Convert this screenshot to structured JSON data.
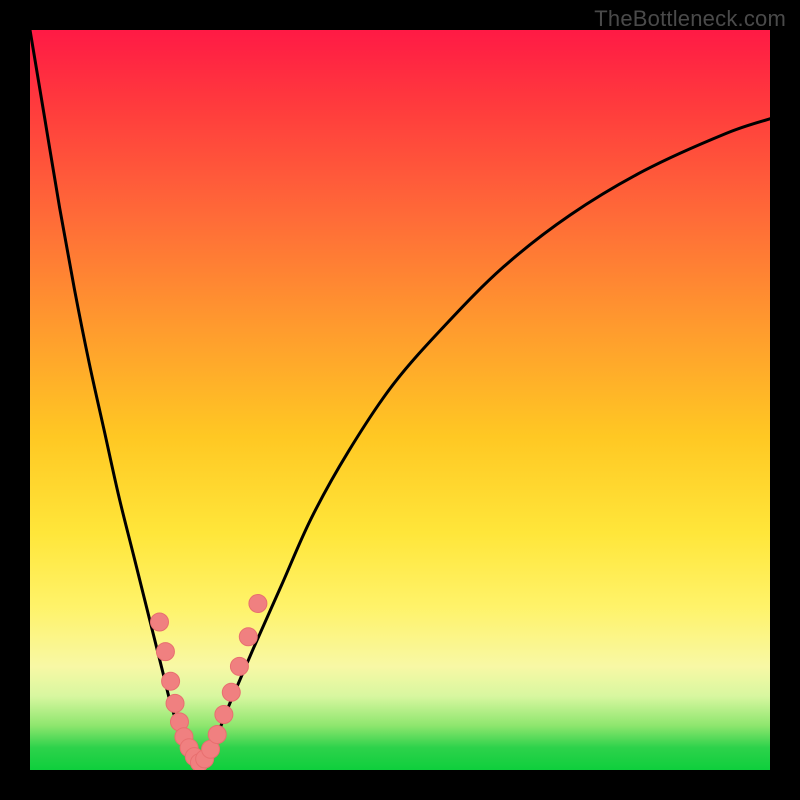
{
  "watermark": "TheBottleneck.com",
  "colors": {
    "frame": "#000000",
    "gradient_top": "#ff1a45",
    "gradient_mid1": "#ff9a2e",
    "gradient_mid2": "#ffe63a",
    "gradient_bottom": "#0ecf3c",
    "curve": "#000000",
    "marker_fill": "#f08080",
    "marker_stroke": "#e86f6f"
  },
  "chart_data": {
    "type": "line",
    "title": "",
    "xlabel": "",
    "ylabel": "",
    "xlim": [
      0,
      100
    ],
    "ylim": [
      0,
      100
    ],
    "note": "V-shaped bottleneck curve. x is relative component balance (0-100), y is bottleneck percentage (0=green/no bottleneck, 100=red/severe). Values are estimated from pixels since no axis ticks are shown.",
    "series": [
      {
        "name": "left-branch",
        "x": [
          0,
          2,
          4,
          6,
          8,
          10,
          12,
          14,
          16,
          18,
          19,
          20,
          21,
          22,
          23
        ],
        "values": [
          100,
          88,
          76,
          65,
          55,
          46,
          37,
          29,
          21,
          13,
          9,
          6,
          4,
          2,
          0
        ]
      },
      {
        "name": "right-branch",
        "x": [
          23,
          25,
          27,
          30,
          34,
          38,
          43,
          49,
          56,
          64,
          73,
          83,
          94,
          100
        ],
        "values": [
          0,
          4,
          9,
          16,
          25,
          34,
          43,
          52,
          60,
          68,
          75,
          81,
          86,
          88
        ]
      }
    ],
    "markers": {
      "name": "sample-points",
      "note": "pink circular markers clustered near the trough along both branches",
      "x": [
        17.5,
        18.3,
        19.0,
        19.6,
        20.2,
        20.8,
        21.5,
        22.2,
        22.9,
        23.6,
        24.4,
        25.3,
        26.2,
        27.2,
        28.3,
        29.5,
        30.8
      ],
      "values": [
        20,
        16,
        12,
        9,
        6.5,
        4.5,
        3,
        1.8,
        1,
        1.5,
        2.8,
        4.8,
        7.5,
        10.5,
        14,
        18,
        22.5
      ]
    }
  }
}
